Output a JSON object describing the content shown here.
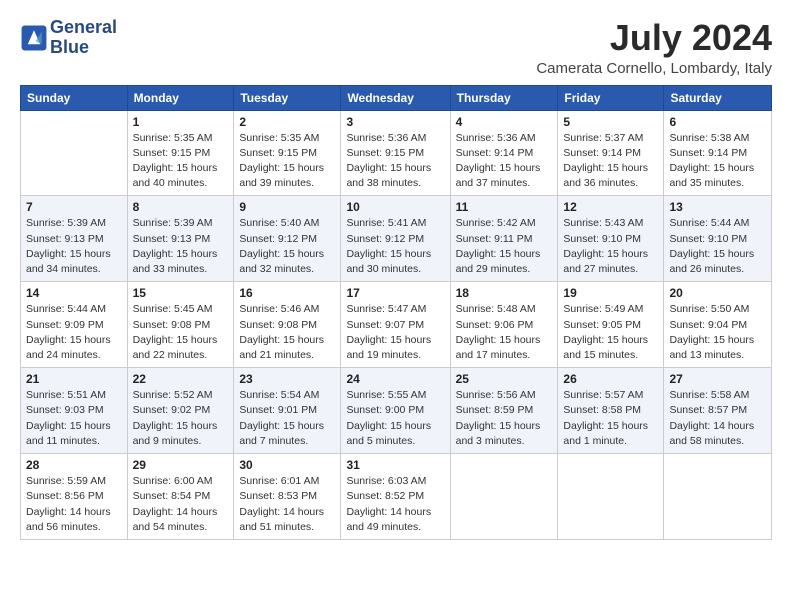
{
  "header": {
    "logo_line1": "General",
    "logo_line2": "Blue",
    "month": "July 2024",
    "location": "Camerata Cornello, Lombardy, Italy"
  },
  "weekdays": [
    "Sunday",
    "Monday",
    "Tuesday",
    "Wednesday",
    "Thursday",
    "Friday",
    "Saturday"
  ],
  "weeks": [
    [
      {
        "day": "",
        "info": ""
      },
      {
        "day": "1",
        "info": "Sunrise: 5:35 AM\nSunset: 9:15 PM\nDaylight: 15 hours\nand 40 minutes."
      },
      {
        "day": "2",
        "info": "Sunrise: 5:35 AM\nSunset: 9:15 PM\nDaylight: 15 hours\nand 39 minutes."
      },
      {
        "day": "3",
        "info": "Sunrise: 5:36 AM\nSunset: 9:15 PM\nDaylight: 15 hours\nand 38 minutes."
      },
      {
        "day": "4",
        "info": "Sunrise: 5:36 AM\nSunset: 9:14 PM\nDaylight: 15 hours\nand 37 minutes."
      },
      {
        "day": "5",
        "info": "Sunrise: 5:37 AM\nSunset: 9:14 PM\nDaylight: 15 hours\nand 36 minutes."
      },
      {
        "day": "6",
        "info": "Sunrise: 5:38 AM\nSunset: 9:14 PM\nDaylight: 15 hours\nand 35 minutes."
      }
    ],
    [
      {
        "day": "7",
        "info": "Sunrise: 5:39 AM\nSunset: 9:13 PM\nDaylight: 15 hours\nand 34 minutes."
      },
      {
        "day": "8",
        "info": "Sunrise: 5:39 AM\nSunset: 9:13 PM\nDaylight: 15 hours\nand 33 minutes."
      },
      {
        "day": "9",
        "info": "Sunrise: 5:40 AM\nSunset: 9:12 PM\nDaylight: 15 hours\nand 32 minutes."
      },
      {
        "day": "10",
        "info": "Sunrise: 5:41 AM\nSunset: 9:12 PM\nDaylight: 15 hours\nand 30 minutes."
      },
      {
        "day": "11",
        "info": "Sunrise: 5:42 AM\nSunset: 9:11 PM\nDaylight: 15 hours\nand 29 minutes."
      },
      {
        "day": "12",
        "info": "Sunrise: 5:43 AM\nSunset: 9:10 PM\nDaylight: 15 hours\nand 27 minutes."
      },
      {
        "day": "13",
        "info": "Sunrise: 5:44 AM\nSunset: 9:10 PM\nDaylight: 15 hours\nand 26 minutes."
      }
    ],
    [
      {
        "day": "14",
        "info": "Sunrise: 5:44 AM\nSunset: 9:09 PM\nDaylight: 15 hours\nand 24 minutes."
      },
      {
        "day": "15",
        "info": "Sunrise: 5:45 AM\nSunset: 9:08 PM\nDaylight: 15 hours\nand 22 minutes."
      },
      {
        "day": "16",
        "info": "Sunrise: 5:46 AM\nSunset: 9:08 PM\nDaylight: 15 hours\nand 21 minutes."
      },
      {
        "day": "17",
        "info": "Sunrise: 5:47 AM\nSunset: 9:07 PM\nDaylight: 15 hours\nand 19 minutes."
      },
      {
        "day": "18",
        "info": "Sunrise: 5:48 AM\nSunset: 9:06 PM\nDaylight: 15 hours\nand 17 minutes."
      },
      {
        "day": "19",
        "info": "Sunrise: 5:49 AM\nSunset: 9:05 PM\nDaylight: 15 hours\nand 15 minutes."
      },
      {
        "day": "20",
        "info": "Sunrise: 5:50 AM\nSunset: 9:04 PM\nDaylight: 15 hours\nand 13 minutes."
      }
    ],
    [
      {
        "day": "21",
        "info": "Sunrise: 5:51 AM\nSunset: 9:03 PM\nDaylight: 15 hours\nand 11 minutes."
      },
      {
        "day": "22",
        "info": "Sunrise: 5:52 AM\nSunset: 9:02 PM\nDaylight: 15 hours\nand 9 minutes."
      },
      {
        "day": "23",
        "info": "Sunrise: 5:54 AM\nSunset: 9:01 PM\nDaylight: 15 hours\nand 7 minutes."
      },
      {
        "day": "24",
        "info": "Sunrise: 5:55 AM\nSunset: 9:00 PM\nDaylight: 15 hours\nand 5 minutes."
      },
      {
        "day": "25",
        "info": "Sunrise: 5:56 AM\nSunset: 8:59 PM\nDaylight: 15 hours\nand 3 minutes."
      },
      {
        "day": "26",
        "info": "Sunrise: 5:57 AM\nSunset: 8:58 PM\nDaylight: 15 hours\nand 1 minute."
      },
      {
        "day": "27",
        "info": "Sunrise: 5:58 AM\nSunset: 8:57 PM\nDaylight: 14 hours\nand 58 minutes."
      }
    ],
    [
      {
        "day": "28",
        "info": "Sunrise: 5:59 AM\nSunset: 8:56 PM\nDaylight: 14 hours\nand 56 minutes."
      },
      {
        "day": "29",
        "info": "Sunrise: 6:00 AM\nSunset: 8:54 PM\nDaylight: 14 hours\nand 54 minutes."
      },
      {
        "day": "30",
        "info": "Sunrise: 6:01 AM\nSunset: 8:53 PM\nDaylight: 14 hours\nand 51 minutes."
      },
      {
        "day": "31",
        "info": "Sunrise: 6:03 AM\nSunset: 8:52 PM\nDaylight: 14 hours\nand 49 minutes."
      },
      {
        "day": "",
        "info": ""
      },
      {
        "day": "",
        "info": ""
      },
      {
        "day": "",
        "info": ""
      }
    ]
  ]
}
